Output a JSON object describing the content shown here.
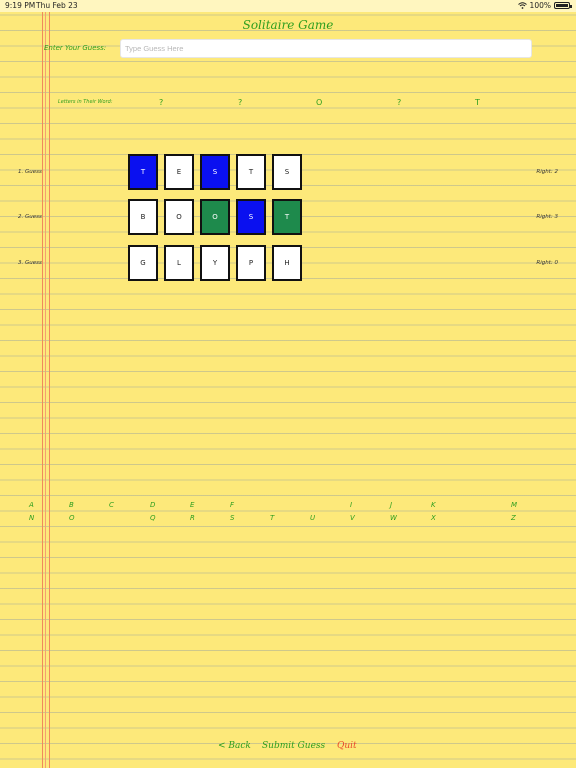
{
  "status_bar": {
    "time": "9:19 PM",
    "date": "Thu Feb 23",
    "battery": "100%"
  },
  "title": "Solitaire Game",
  "guess": {
    "label": "Enter Your Guess:",
    "placeholder": "Type Guess Here"
  },
  "letters_label": "Letters in Their Word:",
  "letter_slots": [
    "?",
    "?",
    "O",
    "?",
    "T"
  ],
  "rows": [
    {
      "label": "1. Guess",
      "right": "Right: 2",
      "tiles": [
        {
          "letter": "T",
          "color": "blue"
        },
        {
          "letter": "E",
          "color": "white"
        },
        {
          "letter": "S",
          "color": "blue"
        },
        {
          "letter": "T",
          "color": "white"
        },
        {
          "letter": "S",
          "color": "white"
        }
      ]
    },
    {
      "label": "2. Guess",
      "right": "Right: 3",
      "tiles": [
        {
          "letter": "B",
          "color": "white"
        },
        {
          "letter": "O",
          "color": "white"
        },
        {
          "letter": "O",
          "color": "green"
        },
        {
          "letter": "S",
          "color": "blue"
        },
        {
          "letter": "T",
          "color": "green"
        }
      ]
    },
    {
      "label": "3. Guess",
      "right": "Right: 0",
      "tiles": [
        {
          "letter": "G",
          "color": "white"
        },
        {
          "letter": "L",
          "color": "white"
        },
        {
          "letter": "Y",
          "color": "white"
        },
        {
          "letter": "P",
          "color": "white"
        },
        {
          "letter": "H",
          "color": "white"
        }
      ]
    }
  ],
  "alphabet_row1": [
    "A",
    "B",
    "C",
    "D",
    "E",
    "F",
    "",
    "",
    "I",
    "J",
    "K",
    "",
    "M"
  ],
  "alphabet_row2": [
    "N",
    "O",
    "",
    "Q",
    "R",
    "S",
    "T",
    "U",
    "V",
    "W",
    "X",
    "",
    "Z"
  ],
  "buttons": {
    "back": "< Back",
    "submit": "Submit Guess",
    "quit": "Quit"
  },
  "colors": {
    "accent": "#2e9e1f",
    "quit": "#e84b2a",
    "paper": "#fde97a",
    "blue_tile": "#0a10f0",
    "green_tile": "#1e8a4c"
  }
}
